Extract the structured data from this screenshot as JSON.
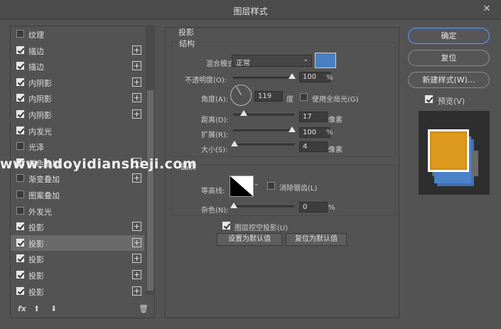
{
  "window": {
    "title": "图层样式",
    "close_glyph": "✕"
  },
  "style_list": {
    "items": [
      {
        "label": "纹理",
        "checked": false,
        "has_add": false
      },
      {
        "label": "描边",
        "checked": true,
        "has_add": true
      },
      {
        "label": "描边",
        "checked": true,
        "has_add": true
      },
      {
        "label": "内阴影",
        "checked": true,
        "has_add": true
      },
      {
        "label": "内阴影",
        "checked": true,
        "has_add": true
      },
      {
        "label": "内阴影",
        "checked": true,
        "has_add": true
      },
      {
        "label": "内发光",
        "checked": true,
        "has_add": false
      },
      {
        "label": "光泽",
        "checked": false,
        "has_add": false
      },
      {
        "label": "颜色叠加",
        "checked": true,
        "has_add": true
      },
      {
        "label": "渐变叠加",
        "checked": false,
        "has_add": true
      },
      {
        "label": "图案叠加",
        "checked": false,
        "has_add": false
      },
      {
        "label": "外发光",
        "checked": false,
        "has_add": false
      },
      {
        "label": "投影",
        "checked": true,
        "has_add": true
      },
      {
        "label": "投影",
        "checked": true,
        "has_add": true,
        "selected": true
      },
      {
        "label": "投影",
        "checked": true,
        "has_add": true
      },
      {
        "label": "投影",
        "checked": true,
        "has_add": true
      },
      {
        "label": "投影",
        "checked": true,
        "has_add": true
      }
    ],
    "add_glyph": "+",
    "footer": {
      "fx": "fx",
      "up": "⬆",
      "down": "⬇",
      "trash": "🗑"
    }
  },
  "drop_shadow": {
    "section_title": "投影",
    "structure": {
      "title": "结构",
      "blend_mode_label": "混合模式:",
      "blend_mode_value": "正常",
      "blend_color": "#4a7fc1",
      "opacity_label": "不透明度(O):",
      "opacity_value": "100",
      "opacity_unit": "%",
      "angle_label": "角度(A):",
      "angle_value": "119",
      "angle_unit": "度",
      "global_light_label": "使用全局光(G)",
      "global_light_checked": false,
      "distance_label": "距离(D):",
      "distance_value": "17",
      "distance_unit": "像素",
      "spread_label": "扩展(R):",
      "spread_value": "100",
      "spread_unit": "%",
      "size_label": "大小(S):",
      "size_value": "4",
      "size_unit": "像素"
    },
    "quality": {
      "title": "品质",
      "contour_label": "等高线:",
      "antialias_label": "消除锯齿(L)",
      "antialias_checked": false,
      "noise_label": "杂色(N):",
      "noise_value": "0",
      "noise_unit": "%"
    },
    "knockout_label": "图层挖空投影(U)",
    "knockout_checked": true,
    "set_default_label": "设置为默认值",
    "reset_default_label": "复位为默认值"
  },
  "buttons": {
    "ok": "确定",
    "reset": "复位",
    "new_style": "新建样式(W)...",
    "preview_label": "预览(V)",
    "preview_checked": true
  },
  "watermark": "www.hdoyidiansheji.com"
}
